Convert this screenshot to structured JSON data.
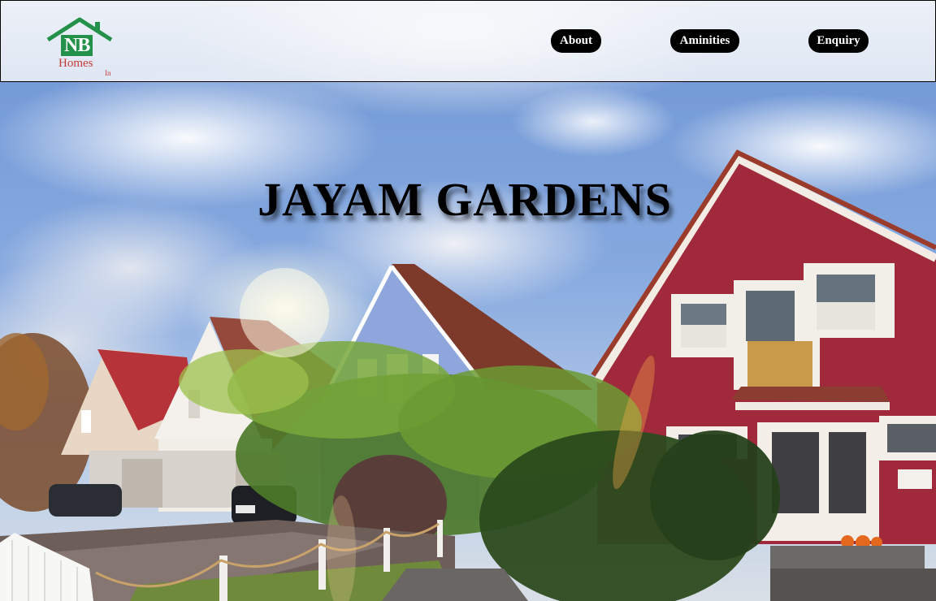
{
  "brand": {
    "logo_mark": "NB",
    "logo_word": "Homes",
    "logo_suffix": "In"
  },
  "nav": {
    "about": "About",
    "amenities": "Aminities",
    "enquiry": "Enquiry"
  },
  "hero": {
    "title": "JAYAM GARDENS"
  },
  "colors": {
    "nav_bg": "#000000",
    "nav_text": "#ffffff",
    "logo_green": "#23914a",
    "logo_red": "#c23a3a"
  }
}
